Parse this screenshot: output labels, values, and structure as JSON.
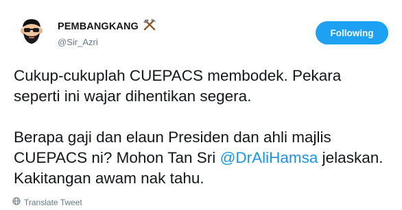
{
  "user": {
    "display_name": "PEMBANGKANG",
    "screen_name": "@Sir_Azri",
    "badge_icon": "hammer-pick-icon"
  },
  "follow_button": {
    "label": "Following",
    "color": "#1da1f2"
  },
  "tweet": {
    "paragraph1": "Cukup-cukuplah CUEPACS membodek. Pekara seperti ini wajar dihentikan segera.",
    "paragraph2_pre": "Berapa gaji dan elaun Presiden dan ahli majlis CUEPACS ni? Mohon Tan Sri ",
    "mention": "@DrAliHamsa",
    "paragraph2_post": " jelaskan. Kakitangan awam nak tahu.",
    "mention_color": "#1b95e0"
  },
  "translate": {
    "label": "Translate Tweet",
    "icon": "globe-icon"
  }
}
